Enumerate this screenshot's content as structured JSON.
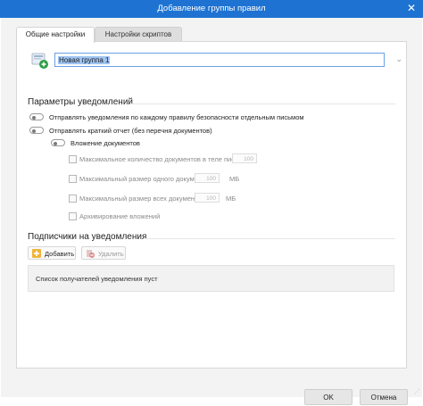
{
  "window": {
    "title": "Добавление группы правил",
    "close_glyph": "✕"
  },
  "tabs": [
    {
      "label": "Общие настройки",
      "active": true
    },
    {
      "label": "Настройки скриптов",
      "active": false
    }
  ],
  "group_name": {
    "value": "Новая группа 1"
  },
  "notifications": {
    "title": "Параметры уведомлений",
    "send_per_rule": "Отправлять уведомления по каждому правилу безопасности отдельным письмом",
    "send_short_report": "Отправлять краткий отчет (без перечня документов)",
    "attach_documents": "Вложение документов",
    "max_docs_in_body": "Максимальное количество документов в теле письма",
    "max_docs_in_body_value": "100",
    "max_single_size": "Максимальный размер одного документа",
    "max_single_size_value": "100",
    "max_all_size": "Максимальный размер всех документов",
    "max_all_size_value": "100",
    "unit_mb": "МБ",
    "archive_attachments": "Архивирование вложений"
  },
  "subscribers": {
    "title": "Подписчики на уведомления",
    "add_label": "Добавить",
    "delete_label": "Удалить",
    "empty_text": "Список получателей уведомления пуст"
  },
  "footer": {
    "ok_label": "OK",
    "cancel_label": "Отмена"
  },
  "icons": {
    "group": "gear-add-icon",
    "add": "add-icon",
    "delete": "delete-icon",
    "dropdown": "chevron-down-icon"
  },
  "colors": {
    "titlebar": "#1e73d2",
    "selection": "#9fc4f3",
    "input_border": "#6aa0e6"
  }
}
